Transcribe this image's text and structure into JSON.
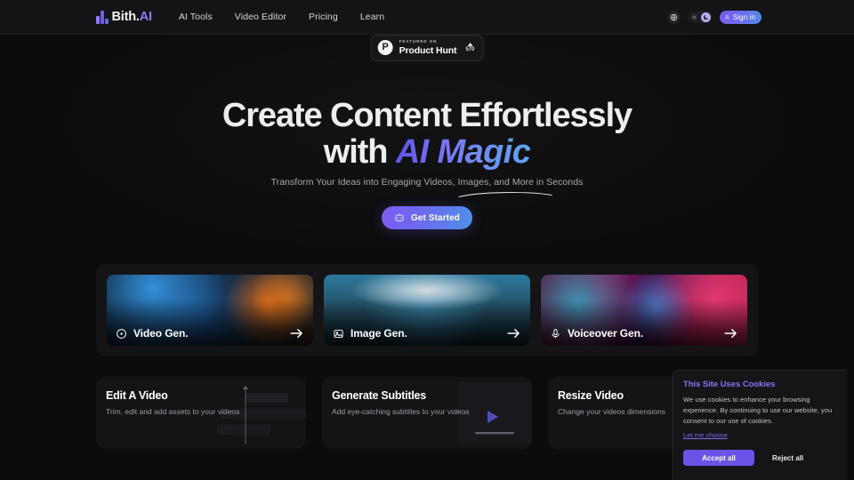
{
  "nav": {
    "logo": {
      "name_main": "Bith.",
      "name_accent": "AI",
      "icon": "bar-logo-icon"
    },
    "links": [
      {
        "label": "AI Tools"
      },
      {
        "label": "Video Editor"
      },
      {
        "label": "Pricing"
      },
      {
        "label": "Learn"
      }
    ],
    "language_icon": "globe-icon",
    "theme": {
      "light_icon": "sun-icon",
      "dark_icon": "moon-icon",
      "active": "dark"
    },
    "signin": {
      "label": "Sign in",
      "icon": "user-icon"
    }
  },
  "hero": {
    "badge": {
      "logo_letter": "P",
      "sub": "FEATURED ON",
      "main": "Product Hunt",
      "votes": "570",
      "caret_icon": "upvote-caret-icon"
    },
    "headline_line1": "Create Content Effortlessly",
    "headline_line2_prefix": "with ",
    "headline_line2_accent": "AI Magic",
    "subtitle": "Transform Your Ideas into Engaging Videos, Images, and More in Seconds",
    "cta": {
      "label": "Get Started",
      "icon": "robot-icon"
    }
  },
  "gen_cards": [
    {
      "label": "Video Gen.",
      "icon": "play-circle-icon",
      "arrow": "arrow-right-icon"
    },
    {
      "label": "Image Gen.",
      "icon": "image-icon",
      "arrow": "arrow-right-icon"
    },
    {
      "label": "Voiceover Gen.",
      "icon": "microphone-icon",
      "arrow": "arrow-right-icon"
    }
  ],
  "feature_cards": [
    {
      "title": "Edit A Video",
      "desc": "Trim, edit and add assets to your videos",
      "deco": "timeline-tracks"
    },
    {
      "title": "Generate Subtitles",
      "desc": "Add eye-catching subtitles to your videos",
      "deco": "play-marker"
    },
    {
      "title": "Resize Video",
      "desc": "Change your videos dimensions",
      "deco": "none"
    }
  ],
  "cookie": {
    "title": "This Site Uses Cookies",
    "body": "We use cookies to enhance your browsing experience. By continuing to use our website, you consent to our use of cookies.",
    "choose_label": "Let me choose",
    "accept_label": "Accept all",
    "reject_label": "Reject all",
    "accent_color": "#6c53e8"
  }
}
